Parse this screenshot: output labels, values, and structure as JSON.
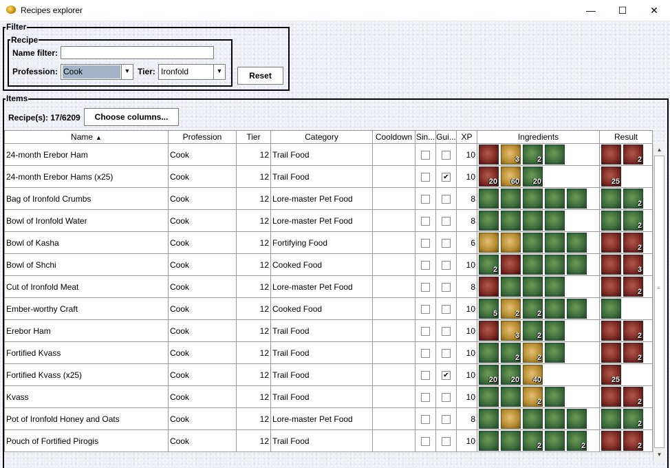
{
  "window": {
    "title": "Recipes explorer",
    "minimize": "—",
    "maximize": "☐",
    "close": "✕"
  },
  "filter": {
    "legend": "Filter",
    "recipe_legend": "Recipe",
    "name_filter_label": "Name filter:",
    "name_filter_value": "",
    "profession_label": "Profession:",
    "profession_value": "Cook",
    "tier_label": "Tier:",
    "tier_value": "Ironfold",
    "reset_label": "Reset"
  },
  "items": {
    "legend": "Items",
    "count_label": "Recipe(s): 17/6209",
    "choose_columns_label": "Choose columns...",
    "columns": [
      "Name",
      "Profession",
      "Tier",
      "Category",
      "Cooldown",
      "Sin...",
      "Gui...",
      "XP",
      "Ingredients",
      "Result"
    ],
    "sort_indicator": "▲",
    "rows": [
      {
        "name": "24-month Erebor Ham",
        "profession": "Cook",
        "tier": "12",
        "category": "Trail Food",
        "cooldown": "",
        "single": false,
        "guild": false,
        "xp": "10",
        "ingredients": [
          {
            "c": "red",
            "n": ""
          },
          {
            "c": "tan",
            "n": "3"
          },
          {
            "c": "green",
            "n": "2"
          },
          {
            "c": "green",
            "n": ""
          }
        ],
        "result": [
          {
            "c": "red",
            "n": ""
          },
          {
            "c": "red",
            "n": "2"
          }
        ]
      },
      {
        "name": "24-month Erebor Hams (x25)",
        "profession": "Cook",
        "tier": "12",
        "category": "Trail Food",
        "cooldown": "",
        "single": false,
        "guild": true,
        "xp": "10",
        "ingredients": [
          {
            "c": "red",
            "n": "20"
          },
          {
            "c": "tan",
            "n": "60"
          },
          {
            "c": "green",
            "n": "20"
          }
        ],
        "result": [
          {
            "c": "red",
            "n": "25"
          }
        ]
      },
      {
        "name": "Bag of Ironfold Crumbs",
        "profession": "Cook",
        "tier": "12",
        "category": "Lore-master Pet Food",
        "cooldown": "",
        "single": false,
        "guild": false,
        "xp": "8",
        "ingredients": [
          {
            "c": "green",
            "n": ""
          },
          {
            "c": "green",
            "n": ""
          },
          {
            "c": "green",
            "n": ""
          },
          {
            "c": "green",
            "n": ""
          },
          {
            "c": "green",
            "n": ""
          }
        ],
        "result": [
          {
            "c": "green",
            "n": ""
          },
          {
            "c": "green",
            "n": "2"
          }
        ]
      },
      {
        "name": "Bowl of Ironfold Water",
        "profession": "Cook",
        "tier": "12",
        "category": "Lore-master Pet Food",
        "cooldown": "",
        "single": false,
        "guild": false,
        "xp": "8",
        "ingredients": [
          {
            "c": "green",
            "n": ""
          },
          {
            "c": "green",
            "n": ""
          },
          {
            "c": "green",
            "n": ""
          },
          {
            "c": "green",
            "n": ""
          }
        ],
        "result": [
          {
            "c": "green",
            "n": ""
          },
          {
            "c": "green",
            "n": "2"
          }
        ]
      },
      {
        "name": "Bowl of Kasha",
        "profession": "Cook",
        "tier": "12",
        "category": "Fortifying Food",
        "cooldown": "",
        "single": false,
        "guild": false,
        "xp": "6",
        "ingredients": [
          {
            "c": "tan",
            "n": ""
          },
          {
            "c": "tan",
            "n": ""
          },
          {
            "c": "green",
            "n": ""
          },
          {
            "c": "green",
            "n": ""
          },
          {
            "c": "green",
            "n": ""
          }
        ],
        "result": [
          {
            "c": "red",
            "n": ""
          },
          {
            "c": "red",
            "n": "2"
          }
        ]
      },
      {
        "name": "Bowl of Shchi",
        "profession": "Cook",
        "tier": "12",
        "category": "Cooked Food",
        "cooldown": "",
        "single": false,
        "guild": false,
        "xp": "10",
        "ingredients": [
          {
            "c": "green",
            "n": "2"
          },
          {
            "c": "red",
            "n": ""
          },
          {
            "c": "green",
            "n": ""
          },
          {
            "c": "green",
            "n": ""
          },
          {
            "c": "green",
            "n": ""
          }
        ],
        "result": [
          {
            "c": "red",
            "n": ""
          },
          {
            "c": "red",
            "n": "3"
          }
        ]
      },
      {
        "name": "Cut of Ironfold Meat",
        "profession": "Cook",
        "tier": "12",
        "category": "Lore-master Pet Food",
        "cooldown": "",
        "single": false,
        "guild": false,
        "xp": "8",
        "ingredients": [
          {
            "c": "red",
            "n": ""
          },
          {
            "c": "green",
            "n": ""
          },
          {
            "c": "green",
            "n": ""
          },
          {
            "c": "green",
            "n": ""
          }
        ],
        "result": [
          {
            "c": "red",
            "n": ""
          },
          {
            "c": "red",
            "n": "2"
          }
        ]
      },
      {
        "name": "Ember-worthy Craft",
        "profession": "Cook",
        "tier": "12",
        "category": "Cooked Food",
        "cooldown": "",
        "single": false,
        "guild": false,
        "xp": "10",
        "ingredients": [
          {
            "c": "green",
            "n": "5"
          },
          {
            "c": "tan",
            "n": "2"
          },
          {
            "c": "green",
            "n": "2"
          },
          {
            "c": "green",
            "n": ""
          },
          {
            "c": "green",
            "n": ""
          }
        ],
        "result": [
          {
            "c": "green",
            "n": ""
          }
        ]
      },
      {
        "name": "Erebor Ham",
        "profession": "Cook",
        "tier": "12",
        "category": "Trail Food",
        "cooldown": "",
        "single": false,
        "guild": false,
        "xp": "10",
        "ingredients": [
          {
            "c": "red",
            "n": ""
          },
          {
            "c": "tan",
            "n": "3"
          },
          {
            "c": "green",
            "n": "2"
          },
          {
            "c": "green",
            "n": ""
          }
        ],
        "result": [
          {
            "c": "red",
            "n": ""
          },
          {
            "c": "red",
            "n": "2"
          }
        ]
      },
      {
        "name": "Fortified Kvass",
        "profession": "Cook",
        "tier": "12",
        "category": "Trail Food",
        "cooldown": "",
        "single": false,
        "guild": false,
        "xp": "10",
        "ingredients": [
          {
            "c": "green",
            "n": ""
          },
          {
            "c": "green",
            "n": "2"
          },
          {
            "c": "tan",
            "n": "2"
          },
          {
            "c": "green",
            "n": ""
          }
        ],
        "result": [
          {
            "c": "red",
            "n": ""
          },
          {
            "c": "red",
            "n": "2"
          }
        ]
      },
      {
        "name": "Fortified Kvass (x25)",
        "profession": "Cook",
        "tier": "12",
        "category": "Trail Food",
        "cooldown": "",
        "single": false,
        "guild": true,
        "xp": "10",
        "ingredients": [
          {
            "c": "green",
            "n": "20"
          },
          {
            "c": "green",
            "n": "20"
          },
          {
            "c": "tan",
            "n": "40"
          }
        ],
        "result": [
          {
            "c": "red",
            "n": "25"
          }
        ]
      },
      {
        "name": "Kvass",
        "profession": "Cook",
        "tier": "12",
        "category": "Trail Food",
        "cooldown": "",
        "single": false,
        "guild": false,
        "xp": "10",
        "ingredients": [
          {
            "c": "green",
            "n": ""
          },
          {
            "c": "green",
            "n": ""
          },
          {
            "c": "tan",
            "n": "2"
          },
          {
            "c": "green",
            "n": ""
          }
        ],
        "result": [
          {
            "c": "red",
            "n": ""
          },
          {
            "c": "red",
            "n": "2"
          }
        ]
      },
      {
        "name": "Pot of Ironfold Honey and Oats",
        "profession": "Cook",
        "tier": "12",
        "category": "Lore-master Pet Food",
        "cooldown": "",
        "single": false,
        "guild": false,
        "xp": "8",
        "ingredients": [
          {
            "c": "green",
            "n": ""
          },
          {
            "c": "tan",
            "n": ""
          },
          {
            "c": "green",
            "n": ""
          },
          {
            "c": "green",
            "n": ""
          },
          {
            "c": "green",
            "n": ""
          }
        ],
        "result": [
          {
            "c": "green",
            "n": ""
          },
          {
            "c": "green",
            "n": "2"
          }
        ]
      },
      {
        "name": "Pouch of Fortified Pirogis",
        "profession": "Cook",
        "tier": "12",
        "category": "Trail Food",
        "cooldown": "",
        "single": false,
        "guild": false,
        "xp": "10",
        "ingredients": [
          {
            "c": "green",
            "n": ""
          },
          {
            "c": "green",
            "n": ""
          },
          {
            "c": "green",
            "n": "2"
          },
          {
            "c": "green",
            "n": ""
          },
          {
            "c": "green",
            "n": "2"
          }
        ],
        "result": [
          {
            "c": "red",
            "n": ""
          },
          {
            "c": "red",
            "n": "2"
          }
        ]
      }
    ]
  },
  "icons": {
    "dropdown": "chevron-down-icon",
    "sort": "sort-ascending-icon"
  }
}
